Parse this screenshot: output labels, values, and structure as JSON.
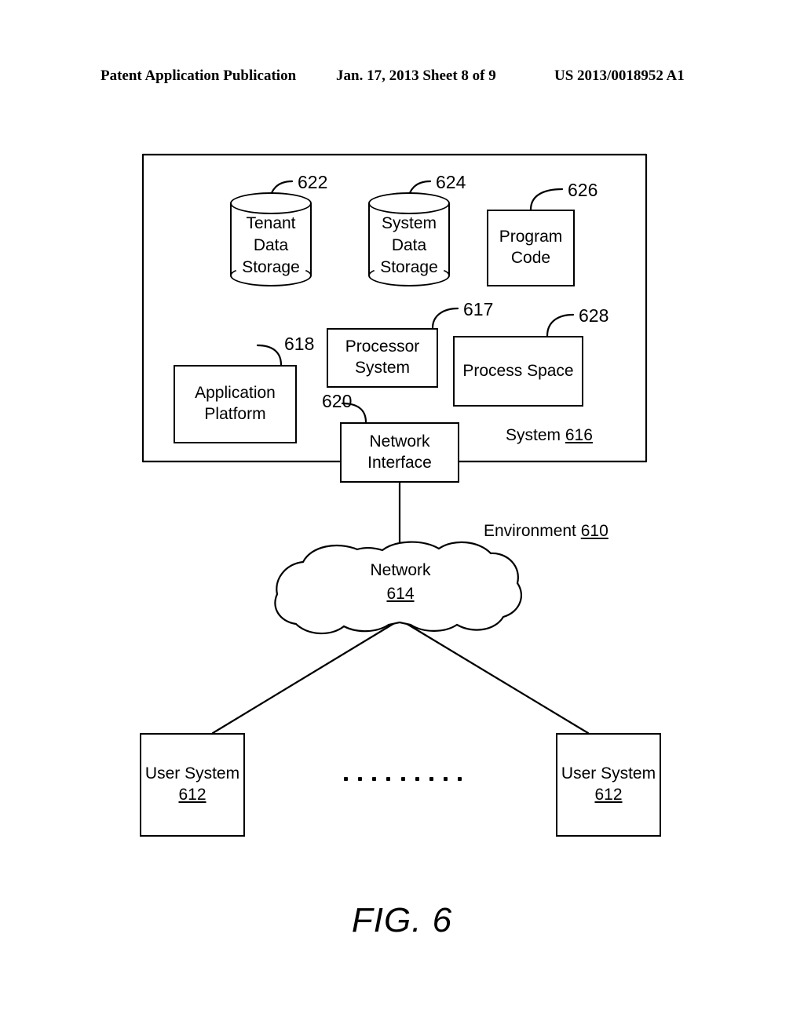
{
  "header": {
    "left": "Patent Application Publication",
    "center": "Jan. 17, 2013  Sheet 8 of 9",
    "right": "US 2013/0018952 A1"
  },
  "figure": {
    "caption": "FIG. 6",
    "system_boundary_label": {
      "text": "System ",
      "ref": "616"
    },
    "environment_label": {
      "text": "Environment ",
      "ref": "610"
    },
    "nodes": {
      "tenant_data_storage": {
        "label_line1": "Tenant",
        "label_line2": "Data",
        "label_line3": "Storage",
        "ref": "622",
        "shape": "cylinder"
      },
      "system_data_storage": {
        "label_line1": "System",
        "label_line2": "Data",
        "label_line3": "Storage",
        "ref": "624",
        "shape": "cylinder"
      },
      "program_code": {
        "label_line1": "Program",
        "label_line2": "Code",
        "ref": "626",
        "shape": "rect"
      },
      "processor_system": {
        "label_line1": "Processor",
        "label_line2": "System",
        "ref": "617",
        "shape": "rect"
      },
      "process_space": {
        "label_line1": "Process Space",
        "ref": "628",
        "shape": "rect"
      },
      "application_platform": {
        "label_line1": "Application",
        "label_line2": "Platform",
        "ref": "618",
        "shape": "rect"
      },
      "network_interface": {
        "label_line1": "Network",
        "label_line2": "Interface",
        "ref": "620",
        "shape": "rect"
      },
      "network_cloud": {
        "label_line1": "Network",
        "ref": "614",
        "shape": "cloud"
      },
      "user_system_left": {
        "label_line1": "User System",
        "ref": "612",
        "shape": "rect"
      },
      "user_system_right": {
        "label_line1": "User System",
        "ref": "612",
        "shape": "rect"
      }
    },
    "ellipsis_dot_count": 9
  }
}
